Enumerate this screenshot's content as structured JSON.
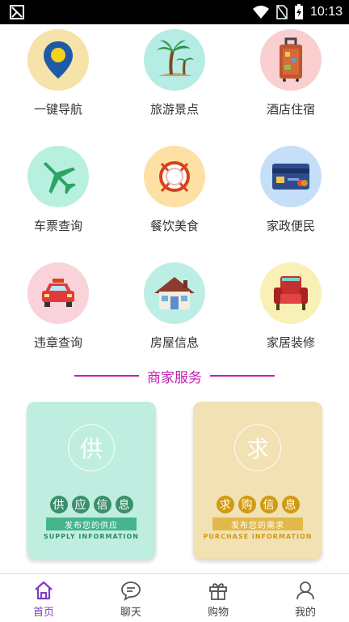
{
  "status_bar": {
    "time": "10:13"
  },
  "grid": [
    {
      "label": "一键导航",
      "icon": "map-pin-icon",
      "bg": "#f6e3a9"
    },
    {
      "label": "旅游景点",
      "icon": "palm-tree-icon",
      "bg": "#b5ece4"
    },
    {
      "label": "酒店住宿",
      "icon": "luggage-icon",
      "bg": "#f9cfcf"
    },
    {
      "label": "车票查询",
      "icon": "airplane-icon",
      "bg": "#b8f0df"
    },
    {
      "label": "餐饮美食",
      "icon": "plate-cutlery-icon",
      "bg": "#fde0a4"
    },
    {
      "label": "家政便民",
      "icon": "credit-card-icon",
      "bg": "#c6dff8"
    },
    {
      "label": "违章查询",
      "icon": "car-icon",
      "bg": "#f9d3d9"
    },
    {
      "label": "房屋信息",
      "icon": "house-icon",
      "bg": "#bdeee5"
    },
    {
      "label": "家居装修",
      "icon": "armchair-icon",
      "bg": "#f8f0b5"
    }
  ],
  "section": {
    "title": "商家服务"
  },
  "cards": {
    "supply": {
      "big_char": "供",
      "chars": [
        "供",
        "应",
        "信",
        "息"
      ],
      "subtitle": "发布您的供应",
      "english": "SUPPLY INFORMATION"
    },
    "purchase": {
      "big_char": "求",
      "chars": [
        "求",
        "购",
        "信",
        "息"
      ],
      "subtitle": "发布您的需求",
      "english": "PURCHASE INFORMATION"
    }
  },
  "tabs": [
    {
      "label": "首页",
      "icon": "home-icon",
      "active": true
    },
    {
      "label": "聊天",
      "icon": "chat-icon",
      "active": false
    },
    {
      "label": "购物",
      "icon": "gift-icon",
      "active": false
    },
    {
      "label": "我的",
      "icon": "user-icon",
      "active": false
    }
  ],
  "colors": {
    "accent": "#c21fb3",
    "active_tab": "#7d3cc9"
  }
}
